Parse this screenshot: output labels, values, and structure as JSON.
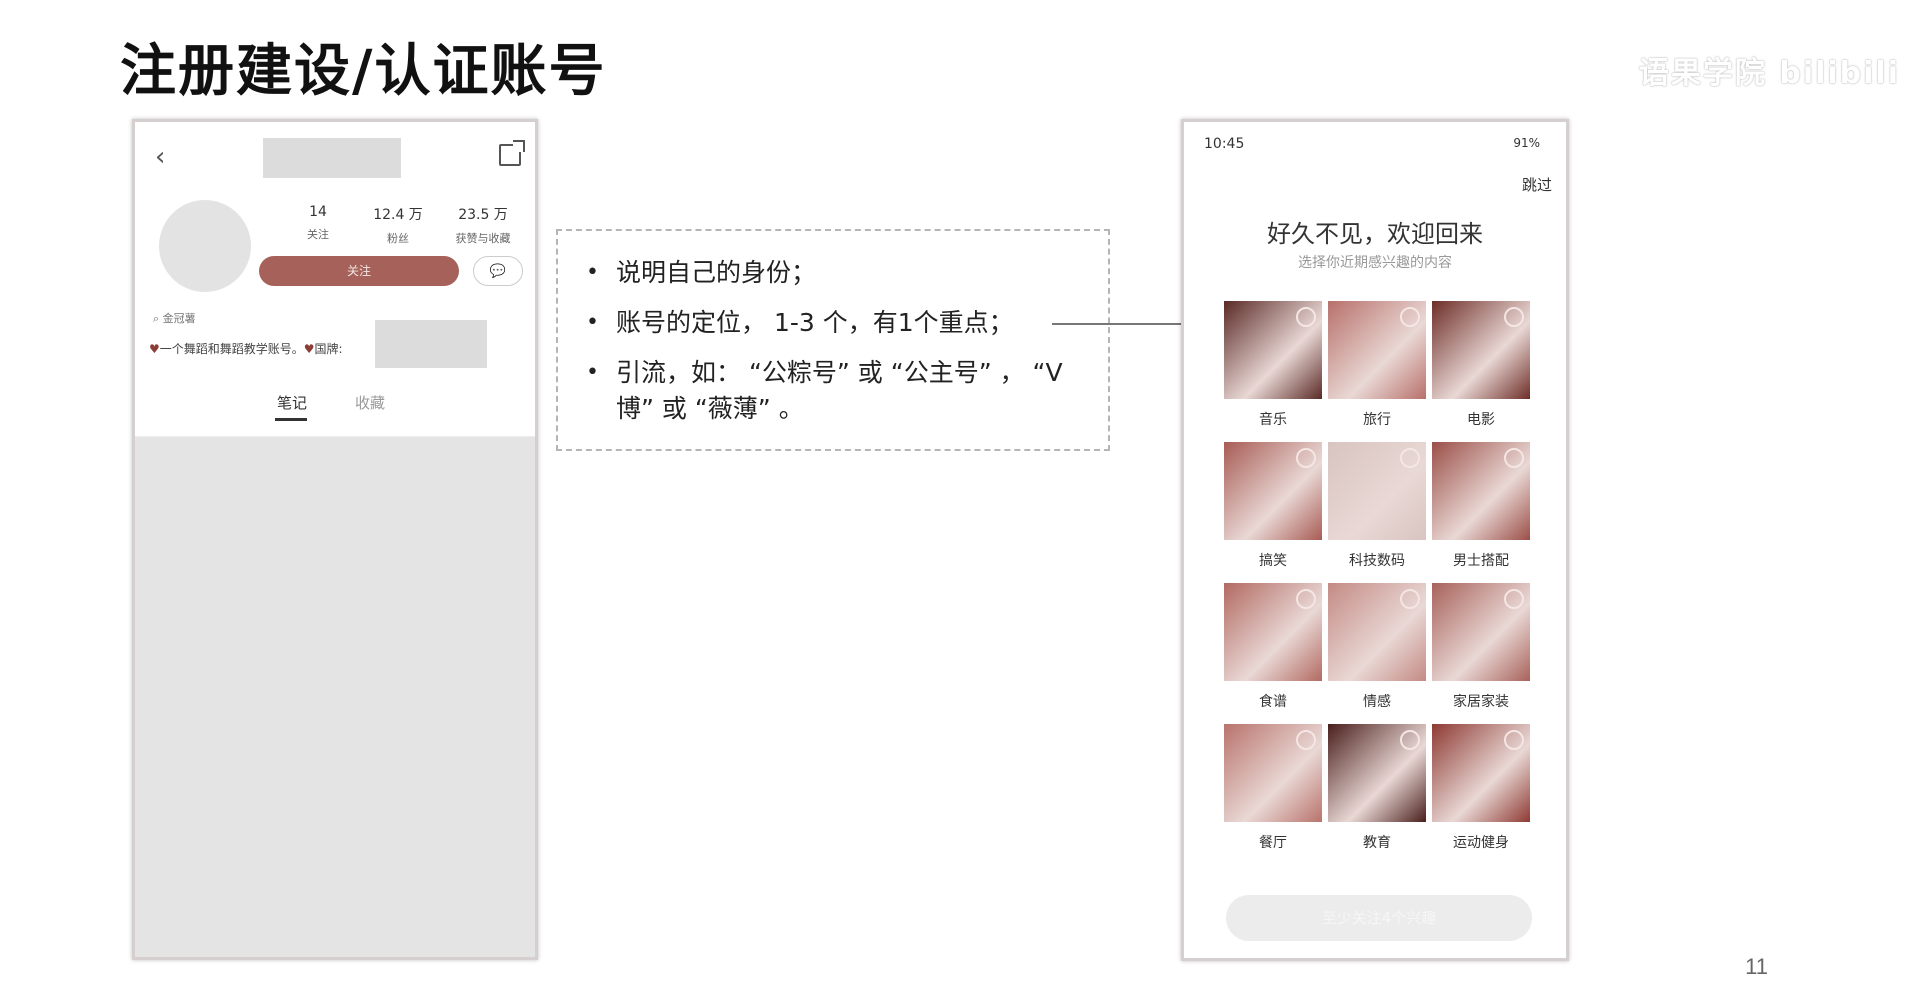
{
  "slide": {
    "title": "注册建设/认证账号",
    "watermark": "语果学院 bilibili",
    "page_number": "11"
  },
  "profile_phone": {
    "back_icon": "chevron-left-icon",
    "share_icon": "share-icon",
    "stats": [
      {
        "value": "14",
        "label": "关注"
      },
      {
        "value": "12.4 万",
        "label": "粉丝"
      },
      {
        "value": "23.5 万",
        "label": "获赞与收藏"
      }
    ],
    "follow_button": "关注",
    "message_icon": "chat-bubble-icon",
    "location": "金冠薯",
    "bio": "一个舞蹈和舞蹈教学账号。",
    "bio_suffix": "国牌:",
    "tabs": [
      "笔记",
      "收藏"
    ]
  },
  "bullets": [
    "说明自己的身份；",
    "账号的定位， 1-3 个，有1个重点；",
    "引流，如： “公粽号” 或 “公主号” ， “V 博” 或 “薇薄” 。"
  ],
  "interest_phone": {
    "status_time": "10:45",
    "status_right": "91%",
    "skip": "跳过",
    "title": "好久不见，欢迎回来",
    "subtitle": "选择你近期感兴趣的内容",
    "categories": [
      {
        "label": "音乐",
        "color": "#5a2a26"
      },
      {
        "label": "旅行",
        "color": "#b8706a"
      },
      {
        "label": "电影",
        "color": "#6e2e28"
      },
      {
        "label": "搞笑",
        "color": "#a85c55"
      },
      {
        "label": "科技数码",
        "color": "#d8c4c0"
      },
      {
        "label": "男士搭配",
        "color": "#9b4f48"
      },
      {
        "label": "食谱",
        "color": "#b26a62"
      },
      {
        "label": "情感",
        "color": "#c48a84"
      },
      {
        "label": "家居家装",
        "color": "#a8625b"
      },
      {
        "label": "餐厅",
        "color": "#b9736c"
      },
      {
        "label": "教育",
        "color": "#4a1f1c"
      },
      {
        "label": "运动健身",
        "color": "#8e3a33"
      }
    ],
    "bottom_button": "至少关注4个兴趣"
  }
}
